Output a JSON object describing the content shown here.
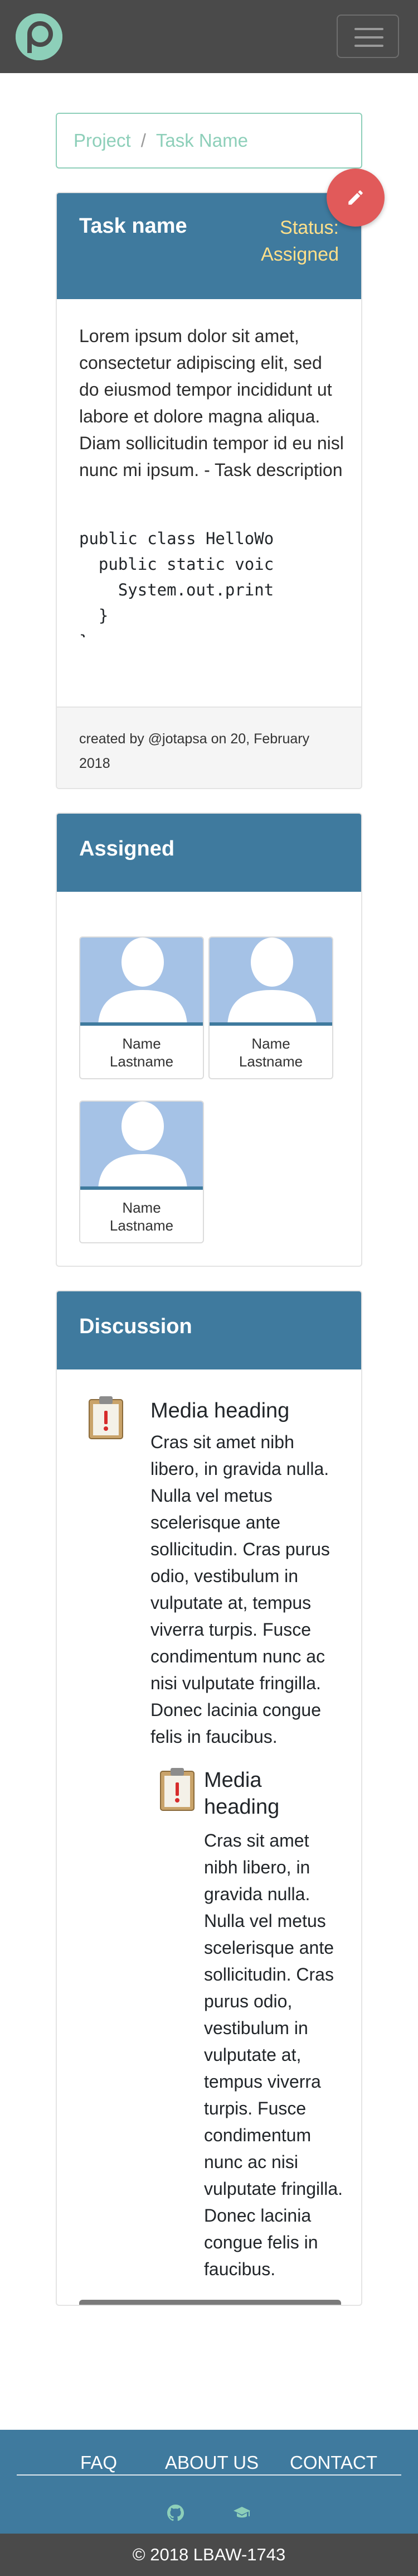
{
  "navbar": {
    "logo_icon": "p-logo-icon",
    "menu_icon": "hamburger-icon"
  },
  "breadcrumb": {
    "project": "Project",
    "separator": "/",
    "task": "Task Name"
  },
  "task": {
    "title": "Task name",
    "status_line1": "Status:",
    "status_line2": "Assigned",
    "description": "Lorem ipsum dolor sit amet, consectetur adipiscing elit, sed do eiusmod tempor incididunt ut labore et dolore magna aliqua. Diam sollicitudin tempor id eu nisl nunc mi ipsum. - Task description",
    "code": "public class HelloWo\n  public static voic\n    System.out.print\n  }\n}",
    "footer_line1": "created by @jotapsa on 20, February",
    "footer_line2": "2018",
    "edit_icon": "pencil-icon"
  },
  "assigned": {
    "title": "Assigned",
    "users": [
      {
        "name_line1": "Name",
        "name_line2": "Lastname"
      },
      {
        "name_line1": "Name",
        "name_line2": "Lastname"
      },
      {
        "name_line1": "Name",
        "name_line2": "Lastname"
      }
    ]
  },
  "discussion": {
    "title": "Discussion",
    "comments": [
      {
        "heading": "Media heading",
        "body": "Cras sit amet nibh libero, in gravida nulla. Nulla vel metus scelerisque ante sollicitudin. Cras purus odio, vestibulum in vulputate at, tempus viverra turpis. Fusce condimentum nunc ac nisi vulputate fringilla. Donec lacinia congue felis in faucibus."
      },
      {
        "heading_line1": "Media",
        "heading_line2": "heading",
        "body": "Cras sit amet nibh libero, in gravida nulla. Nulla vel metus scelerisque ante sollicitudin. Cras purus odio, vestibulum in vulputate at, tempus viverra turpis. Fusce condimentum nunc ac nisi vulputate fringilla. Donec lacinia congue felis in faucibus."
      }
    ],
    "more_label": "..."
  },
  "footer": {
    "links": [
      "FAQ",
      "ABOUT US",
      "CONTACT"
    ],
    "icons": [
      "github-icon",
      "graduation-cap-icon"
    ],
    "copyright": "© 2018 LBAW-1743"
  },
  "colors": {
    "primary": "#3f7a9e",
    "accent": "#8dcfb9",
    "status": "#ffe08a",
    "fab": "#e15a5a",
    "navbar": "#4a4a4a"
  }
}
